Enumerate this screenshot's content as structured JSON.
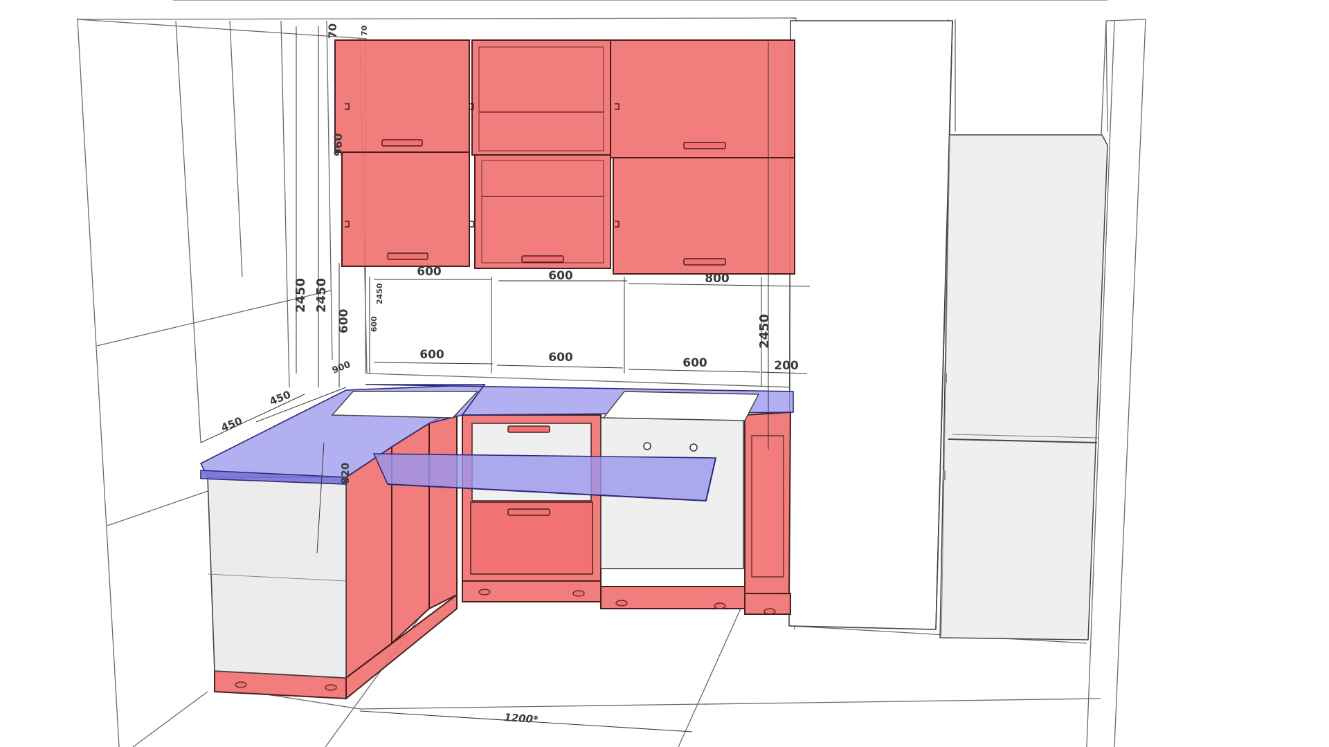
{
  "diagram": {
    "colors": {
      "cabinet_fill": "#f07272",
      "cabinet_stroke": "#4a1e1e",
      "countertop_fill": "#9a96ee",
      "countertop_stroke": "#2c2a78",
      "appliance_fill": "#ececec",
      "line": "#555555",
      "wall": "#ffffff"
    },
    "dimensions": {
      "upper_widths": [
        "600",
        "600",
        "800"
      ],
      "upper_height": "960",
      "upper_top_gap": "70",
      "upper_top_gap_small": "70",
      "base_widths": [
        "600",
        "600",
        "600",
        "200"
      ],
      "wall_height_1": "2450",
      "wall_height_2": "2450",
      "wall_height_small": "2450",
      "wall_height_right": "2450",
      "backsplash_height": "600",
      "backsplash_height_small": "600",
      "left_depth_1": "450",
      "left_depth_2": "450",
      "left_depth_3": "900",
      "counter_height": "820",
      "floor_width": "1200*"
    }
  }
}
